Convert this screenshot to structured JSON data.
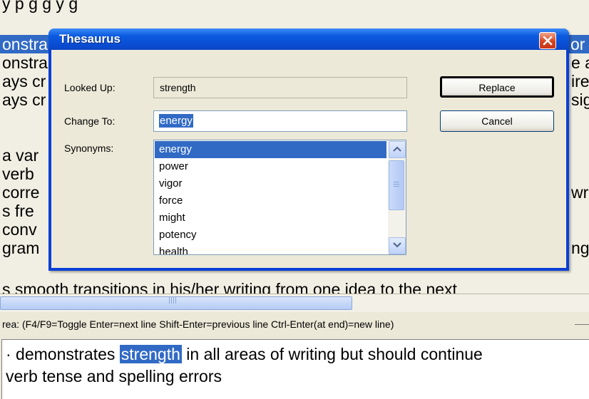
{
  "document": {
    "lines": [
      "...",
      "onstra",
      "onstra",
      "ays cr",
      "ays cr",
      "",
      "a var",
      "verb",
      "corre",
      "s fre",
      "conv",
      "gram"
    ],
    "top_fragment": "y p g      g           y g",
    "right_fragments": [
      "or r",
      "e a",
      "ire",
      "sig",
      "wri",
      "ng"
    ],
    "bottom_line": "s smooth transitions in his/her writing from one idea to the next"
  },
  "hint_bar": {
    "text": "rea:  (F4/F9=Toggle  Enter=next line  Shift-Enter=previous line  Ctrl-Enter(at end)=new line)"
  },
  "editor": {
    "line1_before": "· demonstrates ",
    "line1_highlight": "strength",
    "line1_after": " in all areas of writing but should continue",
    "line2": "verb tense and spelling  errors"
  },
  "dialog": {
    "title": "Thesaurus",
    "looked_up_label": "Looked Up:",
    "looked_up_value": "strength",
    "change_to_label": "Change To:",
    "change_to_value": "energy",
    "synonyms_label": "Synonyms:",
    "synonyms": [
      "energy",
      "power",
      "vigor",
      "force",
      "might",
      "potency",
      "health"
    ],
    "selected_synonym": "energy",
    "replace_label": "Replace",
    "cancel_label": "Cancel"
  },
  "colors": {
    "selection": "#316ac5",
    "titlebar": "#0a4fd4",
    "close": "#d7431f"
  },
  "icons": [
    "close-icon",
    "scroll-up-icon",
    "scroll-down-icon"
  ]
}
